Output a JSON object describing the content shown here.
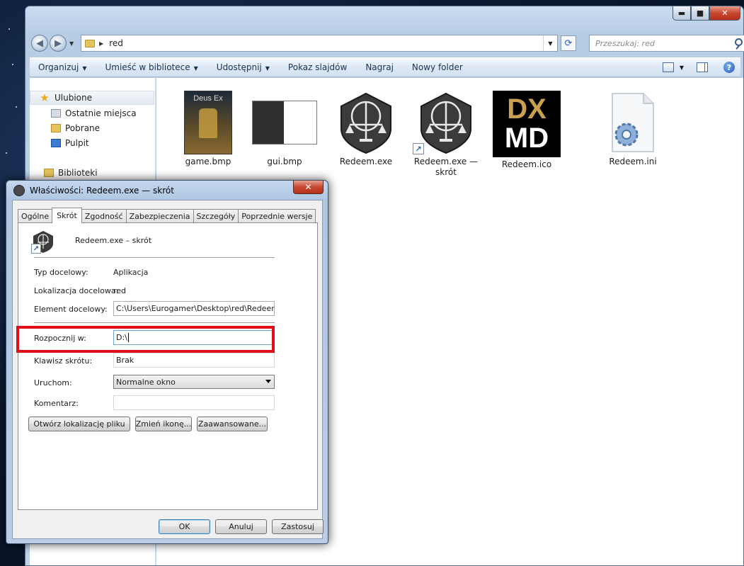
{
  "explorer": {
    "window_controls": {
      "minimize": "▬",
      "maximize": "■",
      "close": "✕"
    },
    "address": {
      "path": "red"
    },
    "search": {
      "placeholder": "Przeszukaj: red"
    },
    "toolbar": {
      "organize": "Organizuj",
      "library": "Umieść w bibliotece",
      "share": "Udostępnij",
      "slideshow": "Pokaz slajdów",
      "burn": "Nagraj",
      "new_folder": "Nowy folder"
    },
    "sidebar": {
      "favorites": "Ulubione",
      "items": [
        "Ostatnie miejsca",
        "Pobrane",
        "Pulpit"
      ],
      "libraries": "Biblioteki"
    },
    "files": [
      {
        "name": "game.bmp",
        "icon": "game-art-thumbnail"
      },
      {
        "name": "gui.bmp",
        "icon": "gui-thumbnail"
      },
      {
        "name": "Redeem.exe",
        "icon": "scales-emblem-icon"
      },
      {
        "name": "Redeem.exe — skrót",
        "icon": "scales-emblem-shortcut-icon"
      },
      {
        "name": "Redeem.ico",
        "icon": "dx-md-logo-icon"
      },
      {
        "name": "Redeem.ini",
        "icon": "settings-file-icon"
      }
    ],
    "thumb_text": {
      "deus_ex": "Deus Ex",
      "dx": "DX",
      "md": "MD"
    }
  },
  "dialog": {
    "title": "Właściwości: Redeem.exe — skrót",
    "close": "✕",
    "tabs": [
      "Ogólne",
      "Skrót",
      "Zgodność",
      "Zabezpieczenia",
      "Szczegóły",
      "Poprzednie wersje"
    ],
    "active_tab": "Skrót",
    "shortcut_name": "Redeem.exe – skrót",
    "fields": {
      "target_type_label": "Typ docelowy:",
      "target_type": "Aplikacja",
      "target_location_label": "Lokalizacja docelowa:",
      "target_location": "red",
      "target_label": "Element docelowy:",
      "target": "C:\\Users\\Eurogamer\\Desktop\\red\\Redeem.exe",
      "start_in_label": "Rozpocznij w:",
      "start_in": "D:\\",
      "shortcut_key_label": "Klawisz skrótu:",
      "shortcut_key": "Brak",
      "run_label": "Uruchom:",
      "run": "Normalne okno",
      "comment_label": "Komentarz:",
      "comment": ""
    },
    "buttons": {
      "open_location": "Otwórz lokalizację pliku",
      "change_icon": "Zmień ikonę...",
      "advanced": "Zaawansowane...",
      "ok": "OK",
      "cancel": "Anuluj",
      "apply": "Zastosuj"
    }
  },
  "colors": {
    "highlight": "#e0101a",
    "accent": "#3c7fb1"
  }
}
